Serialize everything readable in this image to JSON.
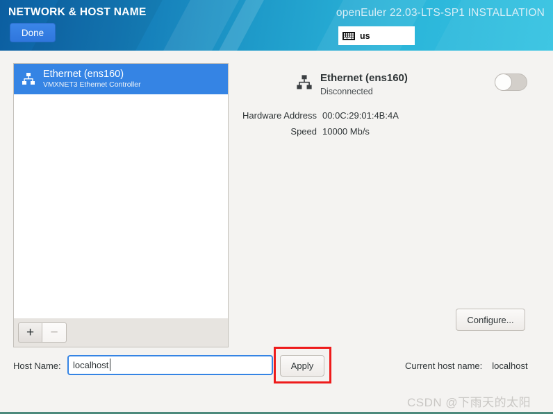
{
  "header": {
    "page_title": "NETWORK & HOST NAME",
    "install_title": "openEuler 22.03-LTS-SP1 INSTALLATION",
    "done_label": "Done",
    "keyboard_layout": "us",
    "keyboard_icon": "keyboard-icon",
    "accent_blue": "#3584e4",
    "gradient_from": "#0c5ea0",
    "gradient_to": "#35c3e2"
  },
  "device_list": {
    "items": [
      {
        "name": "Ethernet (ens160)",
        "description": "VMXNET3 Ethernet Controller",
        "icon": "network-wired-icon",
        "selected": true
      }
    ],
    "toolbar": {
      "add_label": "+",
      "remove_label": "−"
    }
  },
  "detail": {
    "icon": "network-wired-icon",
    "name": "Ethernet (ens160)",
    "status": "Disconnected",
    "toggle_state": "off",
    "properties": [
      {
        "label": "Hardware Address",
        "value": "00:0C:29:01:4B:4A"
      },
      {
        "label": "Speed",
        "value": "10000 Mb/s"
      }
    ],
    "configure_label": "Configure..."
  },
  "hostname": {
    "label": "Host Name:",
    "value": "localhost",
    "placeholder": "",
    "apply_label": "Apply",
    "current_label": "Current host name:",
    "current_value": "localhost",
    "highlight_color": "#ee1b1b"
  },
  "watermark": {
    "text": "CSDN @下雨天的太阳"
  }
}
